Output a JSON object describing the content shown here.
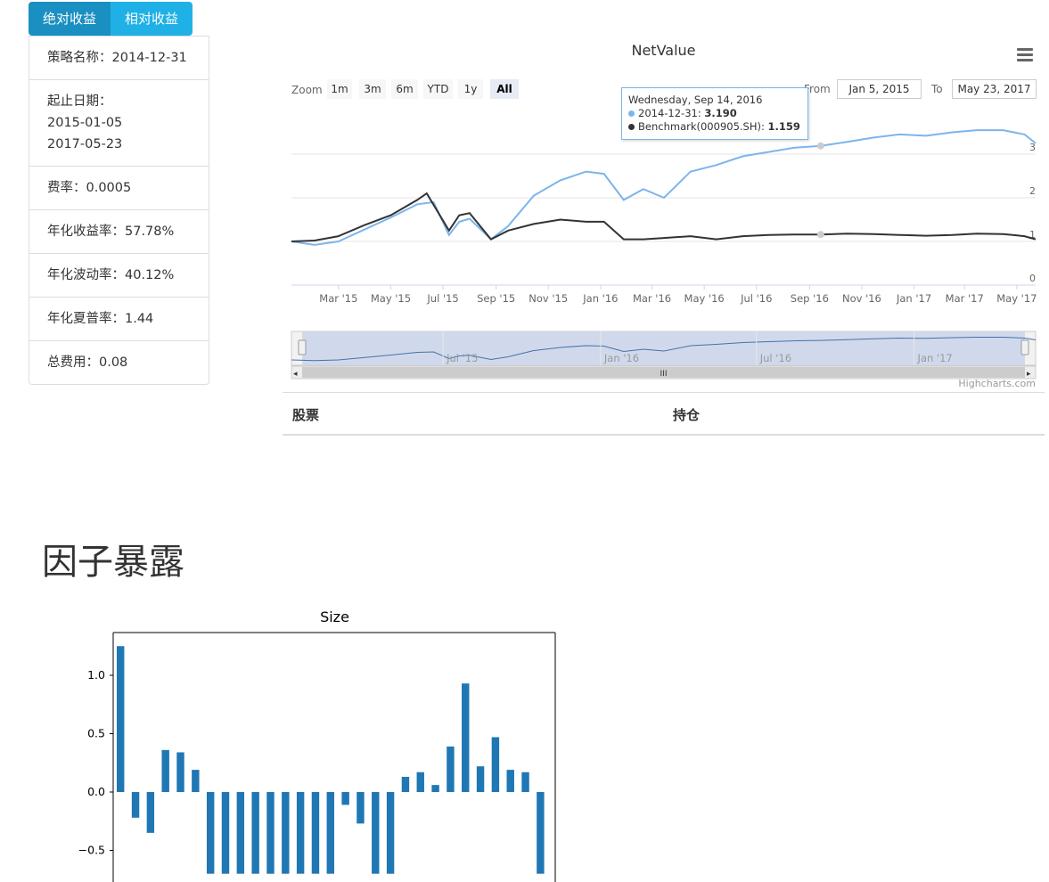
{
  "tabs": [
    {
      "label": "绝对收益",
      "active": true
    },
    {
      "label": "相对收益",
      "active": false
    }
  ],
  "info": {
    "strategy": "策略名称：2014-12-31",
    "period_label": "起止日期：",
    "start_date": "2015-01-05",
    "end_date": "2017-05-23",
    "fee": "费率：0.0005",
    "annual_return": "年化收益率：57.78%",
    "annual_volatility": "年化波动率：40.12%",
    "sharpe": "年化夏普率：1.44",
    "total_cost": "总费用：0.08"
  },
  "netvalue_chart": {
    "title": "NetValue",
    "zoom_label": "Zoom",
    "zoom_buttons": [
      "1m",
      "3m",
      "6m",
      "YTD",
      "1y",
      "All"
    ],
    "zoom_selected": "All",
    "from_label": "From",
    "to_label": "To",
    "from_value": "Jan 5, 2015",
    "to_value": "May 23, 2017",
    "credits": "Highcharts.com",
    "tooltip": {
      "date": "Wednesday, Sep 14, 2016",
      "series1_name": "2014-12-31: ",
      "series1_value": "3.190",
      "series2_name": "Benchmark(000905.SH): ",
      "series2_value": "1.159"
    },
    "colors": {
      "strategy": "#7cb5ec",
      "benchmark": "#333333",
      "navigator": "#ccd6eb"
    }
  },
  "holdings": {
    "col_stock": "股票",
    "col_position": "持仓"
  },
  "factor_section": {
    "title": "因子暴露"
  },
  "chart_data": [
    {
      "type": "line",
      "title": "NetValue",
      "x_ticks": [
        "Mar '15",
        "May '15",
        "Jul '15",
        "Sep '15",
        "Nov '15",
        "Jan '16",
        "Mar '16",
        "May '16",
        "Jul '16",
        "Sep '16",
        "Nov '16",
        "Jan '17",
        "Mar '17",
        "May '17"
      ],
      "y_ticks": [
        0,
        1,
        2,
        3
      ],
      "ylim": [
        0,
        4
      ],
      "navigator_ticks": [
        "Jul '15",
        "Jan '16",
        "Jul '16",
        "Jan '17"
      ],
      "series": [
        {
          "name": "2014-12-31",
          "x": [
            "2015-01-05",
            "2015-02-01",
            "2015-03-01",
            "2015-04-01",
            "2015-05-01",
            "2015-06-01",
            "2015-06-20",
            "2015-07-08",
            "2015-07-20",
            "2015-08-01",
            "2015-08-26",
            "2015-09-15",
            "2015-10-15",
            "2015-11-15",
            "2015-12-15",
            "2016-01-05",
            "2016-01-28",
            "2016-02-20",
            "2016-03-15",
            "2016-04-15",
            "2016-05-15",
            "2016-06-15",
            "2016-07-15",
            "2016-08-15",
            "2016-09-14",
            "2016-10-15",
            "2016-11-15",
            "2016-12-15",
            "2017-01-15",
            "2017-02-15",
            "2017-03-15",
            "2017-04-15",
            "2017-05-10",
            "2017-05-23"
          ],
          "values": [
            1.0,
            0.92,
            1.0,
            1.28,
            1.55,
            1.85,
            1.9,
            1.15,
            1.45,
            1.52,
            1.05,
            1.35,
            2.05,
            2.4,
            2.6,
            2.55,
            1.95,
            2.2,
            2.0,
            2.6,
            2.75,
            2.95,
            3.05,
            3.15,
            3.19,
            3.28,
            3.38,
            3.45,
            3.42,
            3.5,
            3.55,
            3.55,
            3.45,
            3.25
          ]
        },
        {
          "name": "Benchmark(000905.SH)",
          "x": [
            "2015-01-05",
            "2015-02-01",
            "2015-03-01",
            "2015-04-01",
            "2015-05-01",
            "2015-06-01",
            "2015-06-12",
            "2015-07-08",
            "2015-07-20",
            "2015-08-01",
            "2015-08-26",
            "2015-09-15",
            "2015-10-15",
            "2015-11-15",
            "2015-12-15",
            "2016-01-05",
            "2016-01-28",
            "2016-02-20",
            "2016-03-15",
            "2016-04-15",
            "2016-05-15",
            "2016-06-15",
            "2016-07-15",
            "2016-08-15",
            "2016-09-14",
            "2016-10-15",
            "2016-11-15",
            "2016-12-15",
            "2017-01-15",
            "2017-02-15",
            "2017-03-15",
            "2017-04-15",
            "2017-05-10",
            "2017-05-23"
          ],
          "values": [
            1.0,
            1.02,
            1.12,
            1.38,
            1.6,
            1.95,
            2.1,
            1.25,
            1.6,
            1.65,
            1.05,
            1.25,
            1.4,
            1.5,
            1.45,
            1.45,
            1.05,
            1.05,
            1.08,
            1.12,
            1.05,
            1.12,
            1.15,
            1.16,
            1.159,
            1.18,
            1.17,
            1.15,
            1.13,
            1.15,
            1.18,
            1.17,
            1.12,
            1.05
          ]
        }
      ]
    },
    {
      "type": "bar",
      "title": "Size",
      "y_ticks": [
        1.0,
        0.5,
        0.0,
        -0.5
      ],
      "ylim": [
        -0.6,
        1.35
      ],
      "values": [
        1.25,
        -0.22,
        -0.35,
        0.36,
        0.34,
        0.19,
        -0.7,
        -0.7,
        -0.7,
        -0.7,
        -0.7,
        -0.7,
        -0.7,
        -0.7,
        -0.7,
        -0.11,
        -0.27,
        -0.7,
        -0.7,
        0.13,
        0.17,
        0.06,
        0.39,
        0.93,
        0.22,
        0.47,
        0.19,
        0.17,
        -0.7
      ],
      "color": "#1f77b4"
    }
  ]
}
